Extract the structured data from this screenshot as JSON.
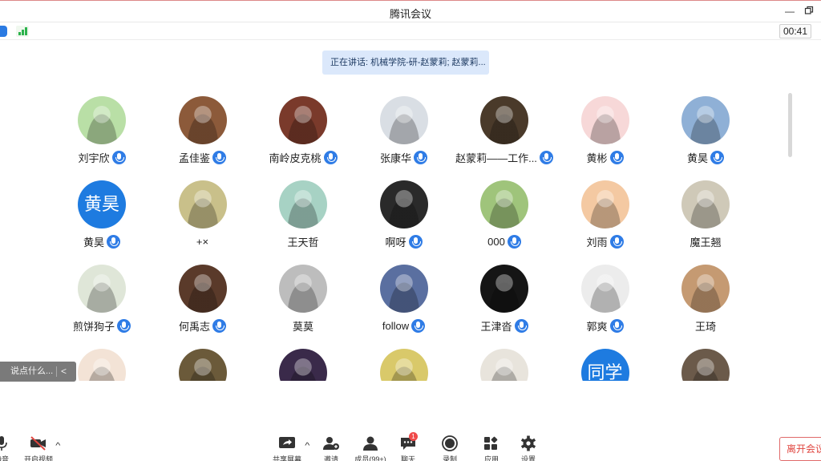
{
  "window": {
    "title": "腾讯会议"
  },
  "status": {
    "timer": "00:41"
  },
  "speaking": {
    "text": "正在讲话: 机械学院-研-赵蒙莉; 赵蒙莉..."
  },
  "participants": [
    {
      "name": "刘宇欣",
      "mic": true,
      "avatar_color": "#b9dfa6"
    },
    {
      "name": "孟佳鉴",
      "mic": true,
      "avatar_color": "#8c5a3a"
    },
    {
      "name": "南岭皮克桃",
      "mic": true,
      "avatar_color": "#7a3a2b"
    },
    {
      "name": "张康华",
      "mic": true,
      "avatar_color": "#d9dee4"
    },
    {
      "name": "赵蒙莉——工作...",
      "mic": true,
      "avatar_color": "#4a3a2a"
    },
    {
      "name": "黄彬",
      "mic": true,
      "avatar_color": "#f7d8d8"
    },
    {
      "name": "黄昊",
      "mic": true,
      "avatar_color": "#8fb0d6"
    },
    {
      "name": "黄昊",
      "mic": true,
      "avatar_color": "#1e7be0",
      "avatar_text": "黄昊"
    },
    {
      "name": "+×",
      "mic": false,
      "avatar_color": "#c9c08a"
    },
    {
      "name": "王天哲",
      "mic": false,
      "avatar_color": "#a7d2c4"
    },
    {
      "name": "啊呀",
      "mic": true,
      "avatar_color": "#2a2a2a"
    },
    {
      "name": "000",
      "mic": true,
      "avatar_color": "#9fc47b"
    },
    {
      "name": "刘雨",
      "mic": true,
      "avatar_color": "#f4c9a2"
    },
    {
      "name": "魔王翘",
      "mic": false,
      "avatar_color": "#cfc9b8"
    },
    {
      "name": "煎饼狗子",
      "mic": true,
      "avatar_color": "#dfe6d8"
    },
    {
      "name": "何禹志",
      "mic": true,
      "avatar_color": "#5a3a2a"
    },
    {
      "name": "莫莫",
      "mic": false,
      "avatar_color": "#bdbdbd"
    },
    {
      "name": "follow",
      "mic": true,
      "avatar_color": "#5a6fa0"
    },
    {
      "name": "王津沓",
      "mic": true,
      "avatar_color": "#151515"
    },
    {
      "name": "郭爽",
      "mic": true,
      "avatar_color": "#ececec"
    },
    {
      "name": "王琦",
      "mic": false,
      "avatar_color": "#c59a72"
    },
    {
      "name": "",
      "mic": false,
      "avatar_color": "#f3e3d6"
    },
    {
      "name": "",
      "mic": false,
      "avatar_color": "#6b5a3a"
    },
    {
      "name": "",
      "mic": false,
      "avatar_color": "#3a2a4a"
    },
    {
      "name": "",
      "mic": false,
      "avatar_color": "#d9c96a"
    },
    {
      "name": "",
      "mic": false,
      "avatar_color": "#e8e4dc"
    },
    {
      "name": "",
      "mic": false,
      "avatar_color": "#1e7be0",
      "avatar_text": "同学"
    },
    {
      "name": "",
      "mic": false,
      "avatar_color": "#6b5a4a"
    }
  ],
  "chat": {
    "placeholder": "说点什么...",
    "collapse": "<"
  },
  "toolbar": {
    "mute_label": "静音",
    "video_label": "开启视频",
    "share_label": "共享屏幕",
    "invite_label": "邀请",
    "members_label": "成员(99+)",
    "chat_label": "聊天",
    "chat_badge": "1",
    "record_label": "录制",
    "apps_label": "应用",
    "settings_label": "设置",
    "leave_label": "离开会议"
  },
  "colors": {
    "accent": "#2f7ce6",
    "leave": "#e0453f",
    "signal": "#2bb24c"
  }
}
